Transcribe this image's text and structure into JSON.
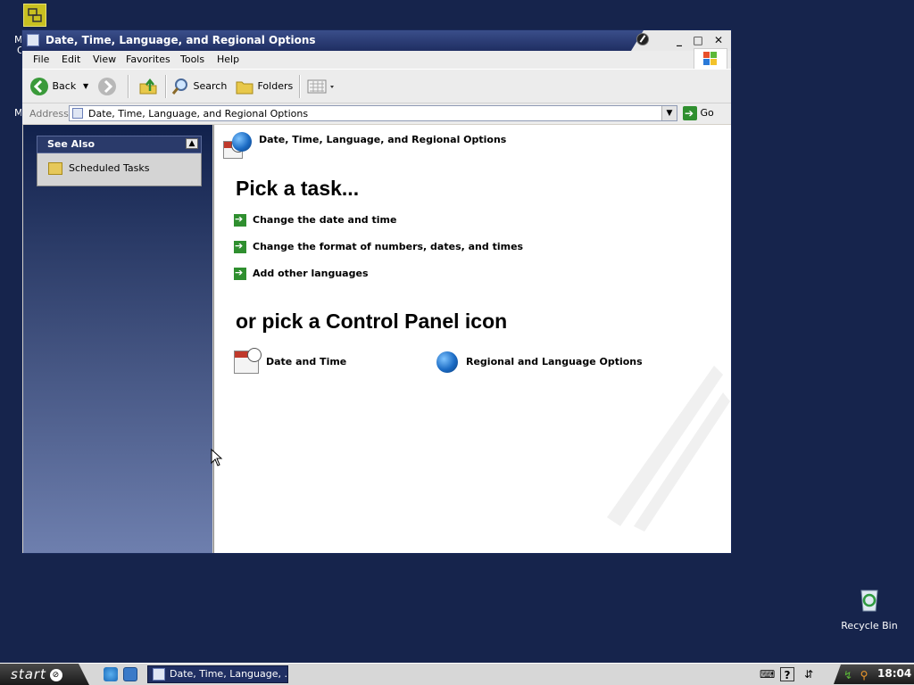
{
  "desktop": {
    "fragment_letters": [
      "M",
      "C",
      "M"
    ],
    "recycle_bin_label": "Recycle Bin"
  },
  "window": {
    "title": "Date, Time, Language, and Regional Options",
    "controls": {
      "minimize": "_",
      "maximize": "□",
      "close": "✕"
    },
    "menu": [
      "File",
      "Edit",
      "View",
      "Favorites",
      "Tools",
      "Help"
    ],
    "toolbar": {
      "back_label": "Back",
      "search_label": "Search",
      "folders_label": "Folders"
    },
    "address": {
      "label": "Address",
      "value": "Date, Time, Language, and Regional Options",
      "go_label": "Go"
    }
  },
  "sidebar": {
    "panel_title": "See Also",
    "items": [
      {
        "label": "Scheduled Tasks"
      }
    ]
  },
  "main": {
    "category_title": "Date, Time, Language, and Regional Options",
    "pick_task_heading": "Pick a task...",
    "tasks": [
      {
        "label": "Change the date and time"
      },
      {
        "label": "Change the format of numbers, dates, and times"
      },
      {
        "label": "Add other languages"
      }
    ],
    "pick_icon_heading": "or pick a Control Panel icon",
    "icons": [
      {
        "label": "Date and Time",
        "icon": "calendar-clock-icon"
      },
      {
        "label": "Regional and Language Options",
        "icon": "globe-icon"
      }
    ]
  },
  "taskbar": {
    "start_label": "start",
    "task_button_label": "Date, Time, Language, ...",
    "clock": "18:04"
  },
  "colors": {
    "desktop": "#16244c",
    "title_bar": "#1f2e62",
    "sidebar_top": "#11214c",
    "task_arrow": "#2f8f2f"
  }
}
